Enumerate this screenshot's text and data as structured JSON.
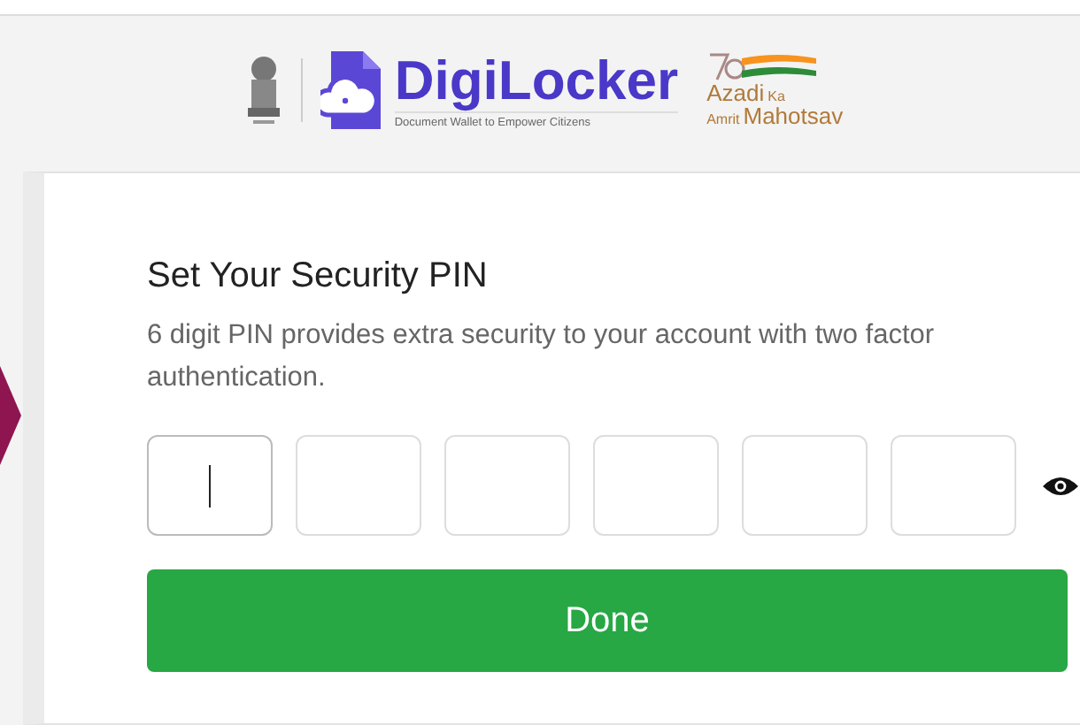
{
  "header": {
    "brand": "DigiLocker",
    "tagline": "Document Wallet to Empower Citizens",
    "campaign": {
      "line_1": "Azadi",
      "line_1_small": "Ka",
      "line_2_small": "Amrit",
      "line_2": "Mahotsav"
    }
  },
  "card": {
    "title": "Set Your Security PIN",
    "description": "6 digit PIN provides extra security to your account with two factor authentication.",
    "pin_boxes": [
      {
        "focused": true
      },
      {
        "focused": false
      },
      {
        "focused": false
      },
      {
        "focused": false
      },
      {
        "focused": false
      },
      {
        "focused": false
      }
    ],
    "submit": "Done"
  }
}
